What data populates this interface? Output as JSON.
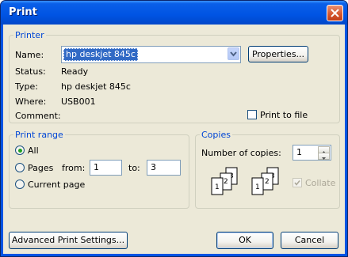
{
  "window": {
    "title": "Print"
  },
  "printer_group": {
    "legend": "Printer",
    "name_label": "Name:",
    "name_value": "hp deskjet 845c",
    "properties_button": "Properties...",
    "status_label": "Status:",
    "status_value": "Ready",
    "type_label": "Type:",
    "type_value": "hp deskjet 845c",
    "where_label": "Where:",
    "where_value": "USB001",
    "comment_label": "Comment:",
    "print_to_file_label": "Print to file",
    "print_to_file_checked": false
  },
  "print_range": {
    "legend": "Print range",
    "all_label": "All",
    "pages_label": "Pages",
    "from_label": "from:",
    "from_value": "1",
    "to_label": "to:",
    "to_value": "3",
    "current_page_label": "Current page",
    "selected": "All"
  },
  "copies": {
    "legend": "Copies",
    "number_label": "Number of copies:",
    "number_value": "1",
    "collate_label": "Collate",
    "collate_checked": true,
    "collate_enabled": false,
    "page_numbers": [
      "1",
      "2",
      "3"
    ]
  },
  "footer": {
    "advanced_button": "Advanced Print Settings...",
    "ok_button": "OK",
    "cancel_button": "Cancel"
  },
  "colors": {
    "title_bar": "#0054e3",
    "dialog_bg": "#ece9d8",
    "legend_text": "#0046d5",
    "selection": "#316ac5"
  }
}
